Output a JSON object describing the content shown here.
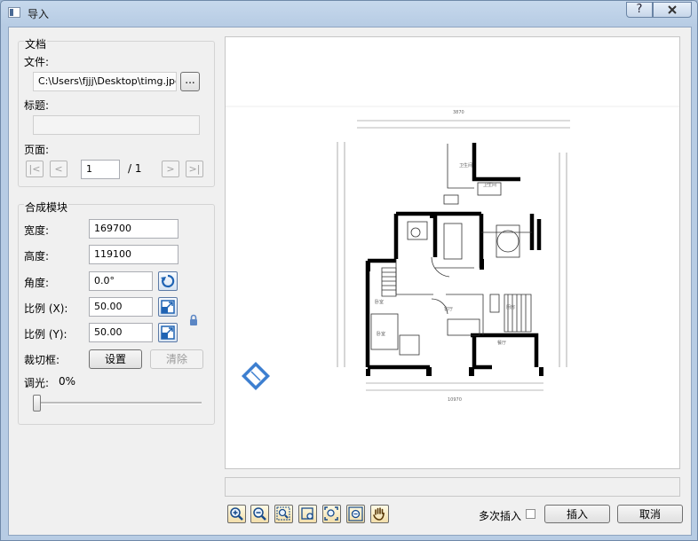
{
  "window": {
    "title": "导入",
    "help_symbol": "?",
    "close_symbol": "X"
  },
  "document": {
    "section_label": "文档",
    "file_label": "文件:",
    "file_path": "C:\\Users\\fjjj\\Desktop\\timg.jpg",
    "browse_label": "...",
    "title_label": "标题:",
    "title_value": "",
    "page_label": "页面:",
    "first_label": "|<",
    "prev_label": "<",
    "page_value": "1",
    "page_total": "/ 1",
    "next_label": ">",
    "last_label": ">|"
  },
  "composite": {
    "section_label": "合成模块",
    "width_label": "宽度:",
    "width_value": "169700",
    "height_label": "高度:",
    "height_value": "119100",
    "angle_label": "角度:",
    "angle_value": "0.0°",
    "scale_x_label": "比例 (X):",
    "scale_x_value": "50.00",
    "scale_y_label": "比例 (Y):",
    "scale_y_value": "50.00",
    "clip_label": "裁切框:",
    "set_label": "设置",
    "clear_label": "清除",
    "fade_label": "调光:",
    "fade_value": "0%",
    "fade_level": 0
  },
  "footer": {
    "multi_insert_label": "多次插入",
    "insert_label": "插入",
    "cancel_label": "取消",
    "status_text": ""
  },
  "colors": {
    "accent": "#2f6db5",
    "titlebar": "#c6d8ec",
    "window_bg": "#f0f0f0"
  }
}
